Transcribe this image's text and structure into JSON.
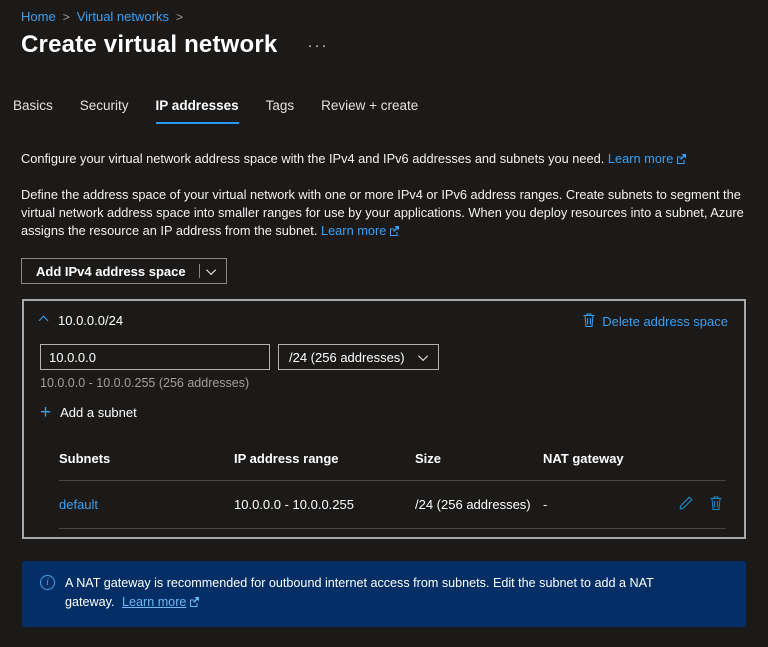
{
  "breadcrumb": {
    "items": [
      {
        "label": "Home"
      },
      {
        "label": "Virtual networks"
      }
    ],
    "separator": ">"
  },
  "header": {
    "title": "Create virtual network",
    "more_menu": "···"
  },
  "tabs": [
    {
      "label": "Basics",
      "active": false
    },
    {
      "label": "Security",
      "active": false
    },
    {
      "label": "IP addresses",
      "active": true
    },
    {
      "label": "Tags",
      "active": false
    },
    {
      "label": "Review + create",
      "active": false
    }
  ],
  "intro": {
    "text": "Configure your virtual network address space with the IPv4 and IPv6 addresses and subnets you need.",
    "learn_more_label": "Learn more"
  },
  "description": {
    "text": "Define the address space of your virtual network with one or more IPv4 or IPv6 address ranges. Create subnets to segment the virtual network address space into smaller ranges for use by your applications. When you deploy resources into a subnet, Azure assigns the resource an IP address from the subnet.",
    "learn_more_label": "Learn more"
  },
  "toolbar": {
    "add_address_space_label": "Add IPv4 address space"
  },
  "address_space": {
    "title": "10.0.0.0/24",
    "delete_label": "Delete address space",
    "ip_value": "10.0.0.0",
    "prefix_selected": "/24 (256 addresses)",
    "range_summary": "10.0.0.0 - 10.0.0.255 (256 addresses)",
    "add_subnet_label": "Add a subnet",
    "table": {
      "headers": [
        "Subnets",
        "IP address range",
        "Size",
        "NAT gateway"
      ],
      "rows": [
        {
          "subnet": "default",
          "range": "10.0.0.0 - 10.0.0.255",
          "size": "/24 (256 addresses)",
          "nat_gateway": "-"
        }
      ]
    }
  },
  "info_banner": {
    "text": "A NAT gateway is recommended for outbound internet access from subnets. Edit the subnet to add a NAT gateway.",
    "learn_more_label": "Learn more"
  },
  "colors": {
    "background": "#1b1a19",
    "link_blue": "#3aa0f3",
    "active_tab_underline": "#2899f5",
    "card_border": "#a8a8a8",
    "banner_background": "#042e66",
    "muted_text": "#a19f9d"
  }
}
